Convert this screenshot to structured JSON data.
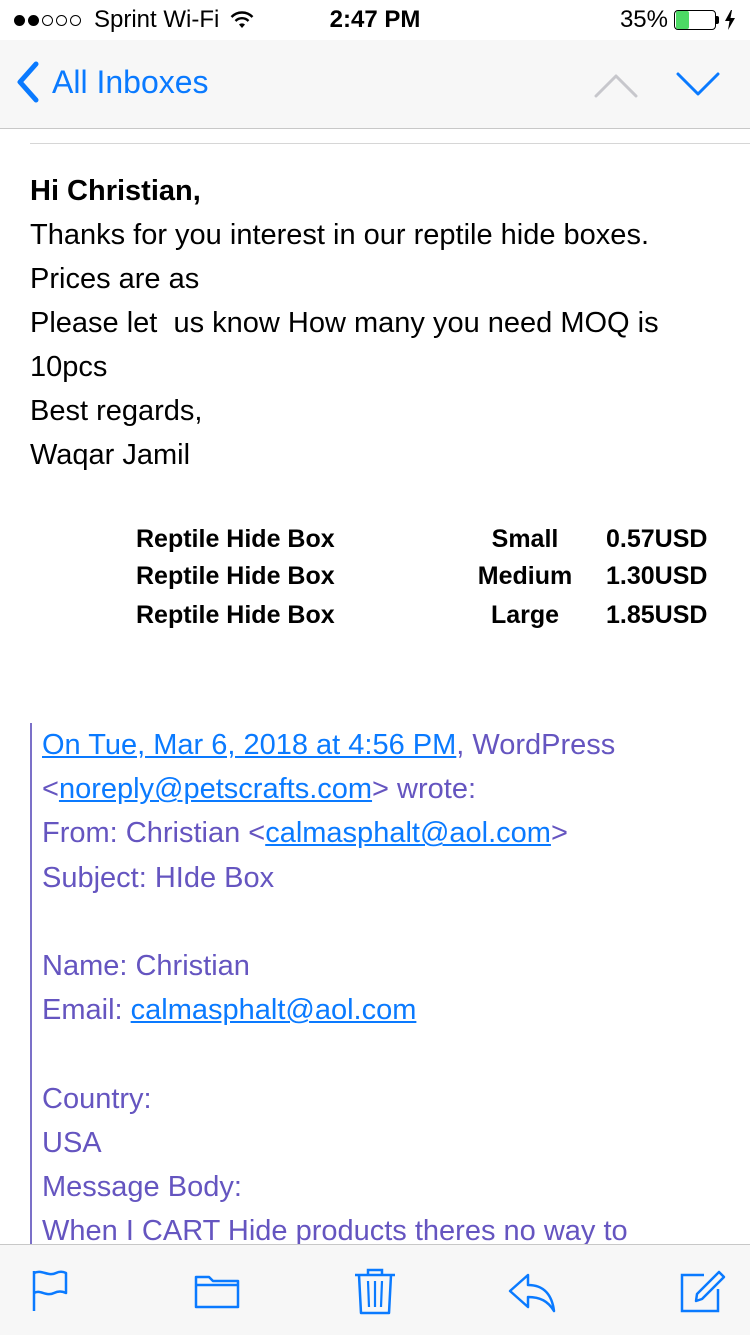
{
  "status_bar": {
    "carrier": "Sprint Wi-Fi",
    "signal_dots_filled": 2,
    "signal_dots_total": 5,
    "time": "2:47 PM",
    "battery_percent_text": "35%",
    "battery_level": 0.35,
    "battery_color": "#4cd964"
  },
  "nav": {
    "back_label": "All Inboxes",
    "accent_color": "#0a7aff",
    "icons": [
      "chevron-left-icon",
      "chevron-up-icon",
      "chevron-down-icon"
    ]
  },
  "message": {
    "greeting": "Hi Christian,",
    "lines": [
      "Thanks for you interest in our reptile hide boxes.",
      "Prices are as",
      "Please let  us know How many you need MOQ is",
      "10pcs",
      "Best regards,",
      "Waqar Jamil"
    ],
    "price_table": [
      {
        "product": "Reptile Hide Box",
        "size": "Small",
        "price": "0.57USD"
      },
      {
        "product": "Reptile Hide Box",
        "size": "Medium",
        "price": "1.30USD"
      },
      {
        "product": "Reptile Hide Box",
        "size": "Large",
        "price": "1.85USD"
      }
    ]
  },
  "quoted": {
    "date_link": "On Tue, Mar 6, 2018 at 4:56 PM",
    "sender_name": ", WordPress",
    "sender_email_open": "<",
    "sender_email": "noreply@petscrafts.com",
    "sender_email_close": "> wrote:",
    "from_label": "From: Christian <",
    "from_email": "calmasphalt@aol.com",
    "from_close": ">",
    "subject": "Subject: HIde Box",
    "name": "Name: Christian",
    "email_label": "Email: ",
    "email_value": "calmasphalt@aol.com",
    "country_label": "Country:",
    "country_value": "USA",
    "message_label": "Message Body:",
    "message_value": "When I CART Hide products theres no way to",
    "quote_color": "#6555c0"
  },
  "toolbar": {
    "icons": [
      "flag-icon",
      "folder-icon",
      "trash-icon",
      "reply-icon",
      "compose-icon"
    ]
  }
}
